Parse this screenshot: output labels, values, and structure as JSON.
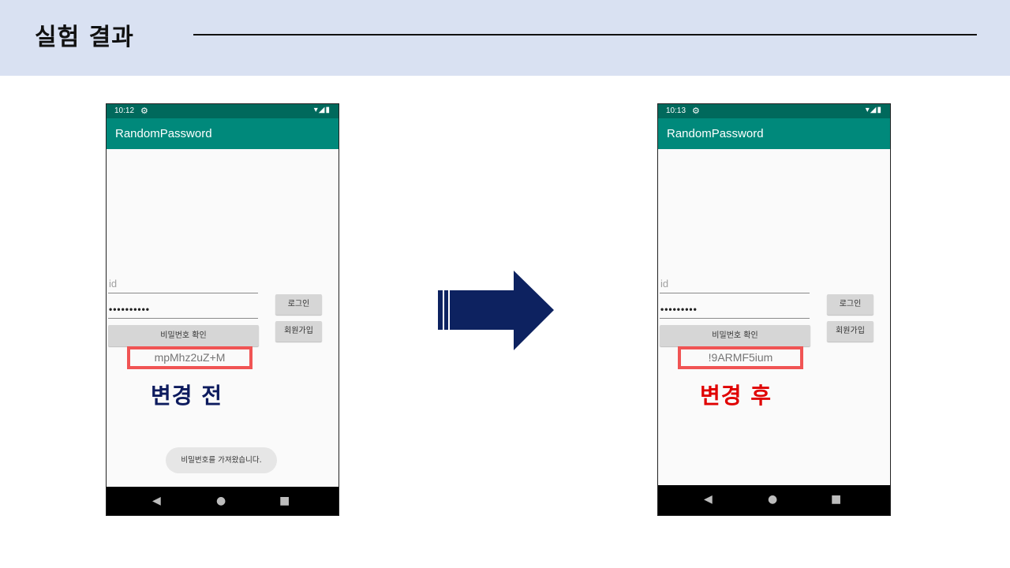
{
  "slide": {
    "title": "실험 결과",
    "colors": {
      "header_band": "#d9e1f2",
      "arrow": "#0d2260",
      "highlight_box": "#f05454"
    }
  },
  "before_phone": {
    "status_bar": {
      "time": "10:12",
      "settings_icon": "gear-icon",
      "signal_icons": "▾◢▮"
    },
    "app_bar": {
      "title": "RandomPassword"
    },
    "id_field": {
      "placeholder": "id"
    },
    "password_field": {
      "value": "••••••••••"
    },
    "login_button": "로그인",
    "signup_button": "회원가입",
    "check_password_button": "비밀번호 확인",
    "shown_password": "mpMhz2uZ+M",
    "caption": "변경 전",
    "toast": "비밀번호를 가져왔습니다.",
    "nav": {
      "back": "◀",
      "home": "●",
      "recents": "■"
    }
  },
  "after_phone": {
    "status_bar": {
      "time": "10:13",
      "settings_icon": "gear-icon",
      "signal_icons": "▾◢▮"
    },
    "app_bar": {
      "title": "RandomPassword"
    },
    "id_field": {
      "placeholder": "id"
    },
    "password_field": {
      "value": "•••••••••"
    },
    "login_button": "로그인",
    "signup_button": "회원가입",
    "check_password_button": "비밀번호 확인",
    "shown_password": "!9ARMF5ium",
    "caption": "변경 후",
    "nav": {
      "back": "◀",
      "home": "●",
      "recents": "■"
    }
  }
}
